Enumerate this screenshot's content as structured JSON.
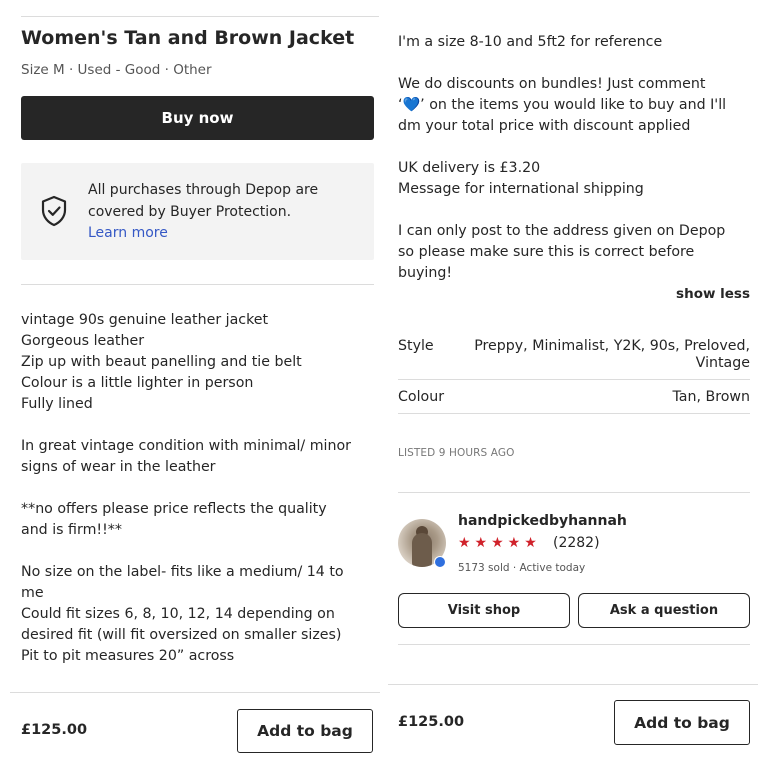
{
  "product": {
    "title": "Women's Tan and Brown Jacket",
    "subtitle": "Size M · Used - Good · Other",
    "buy_label": "Buy now"
  },
  "protection": {
    "text": "All purchases through Depop are covered by Buyer Protection.",
    "learn_more": "Learn more",
    "icon": "shield-check-icon"
  },
  "description_left": [
    "vintage 90s genuine leather jacket",
    "Gorgeous leather",
    "Zip up with beaut panelling and tie belt",
    "Colour is a little lighter in person",
    "Fully lined",
    "",
    "In great vintage condition with minimal/ minor",
    "signs of wear in the leather",
    "",
    "**no offers please price reflects the quality",
    "and is firm!!**",
    "",
    "No size on the label- fits like a medium/ 14 to",
    "me",
    "Could fit sizes 6, 8, 10, 12, 14 depending on",
    "desired fit (will fit oversized on smaller sizes)",
    "Pit to pit measures 20” across"
  ],
  "description_right": [
    "I'm a size 8-10 and 5ft2 for reference",
    "",
    "We do discounts on bundles! Just comment",
    "‘💙’ on the items you would like to buy and I'll",
    "dm your total price with discount applied",
    "",
    "UK delivery is £3.20",
    "Message for international shipping",
    "",
    "I can only post to the address given on Depop",
    "so please make sure this is correct before",
    "buying!"
  ],
  "show_less": "show less",
  "attributes": {
    "style_label": "Style",
    "style_value_1": "Preppy, Minimalist, Y2K, 90s, Preloved,",
    "style_value_2": "Vintage",
    "colour_label": "Colour",
    "colour_value": "Tan, Brown"
  },
  "listed": "LISTED 9 HOURS AGO",
  "seller": {
    "name": "handpickedbyhannah",
    "stars": "★★★★★",
    "rating_count": "(2282)",
    "meta": "5173 sold · Active today",
    "visit_shop": "Visit shop",
    "ask_question": "Ask a question"
  },
  "footer_left": {
    "price": "£125.00",
    "add_label": "Add to bag"
  },
  "footer_right": {
    "price": "£125.00",
    "add_label": "Add to bag"
  },
  "colors": {
    "primary_button": "#262626",
    "link": "#3558c5",
    "stars": "#d0222b",
    "verified": "#2f6fde"
  }
}
